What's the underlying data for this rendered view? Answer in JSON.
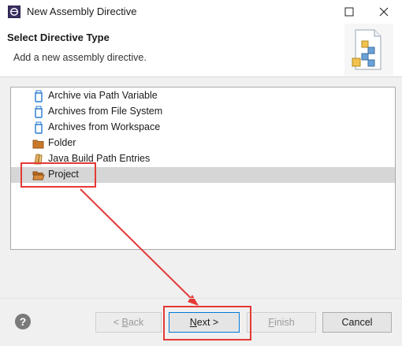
{
  "window": {
    "title": "New Assembly Directive"
  },
  "header": {
    "title": "Select Directive Type",
    "description": "Add a new assembly directive."
  },
  "list": {
    "items": [
      {
        "label": "Archive via Path Variable",
        "icon": "jar-icon"
      },
      {
        "label": "Archives from File System",
        "icon": "jar-icon"
      },
      {
        "label": "Archives from Workspace",
        "icon": "jar-icon"
      },
      {
        "label": "Folder",
        "icon": "folder-icon"
      },
      {
        "label": "Java Build Path Entries",
        "icon": "library-icon"
      },
      {
        "label": "Project",
        "icon": "open-folder-icon",
        "selected": true
      }
    ]
  },
  "buttons": {
    "help": "?",
    "back_pre": "< ",
    "back_u": "B",
    "back_post": "ack",
    "next_u": "N",
    "next_post": "ext >",
    "finish_u": "F",
    "finish_post": "inish",
    "cancel": "Cancel"
  },
  "colors": {
    "accent": "#0078d7",
    "annotation": "#e53935",
    "selection": "#d6d6d6"
  }
}
